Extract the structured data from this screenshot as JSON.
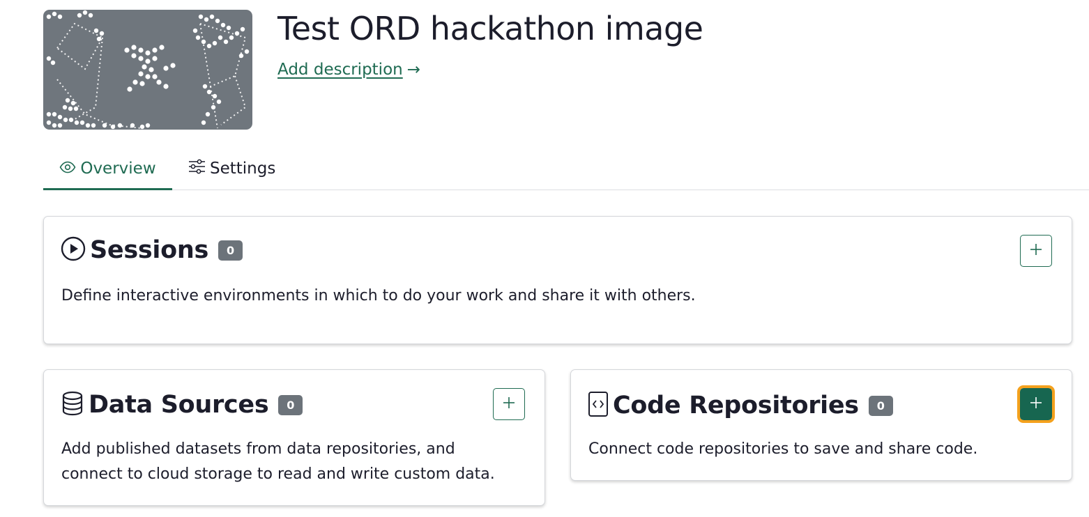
{
  "project": {
    "title": "Test ORD hackathon image",
    "add_description": "Add description",
    "add_description_arrow": "→"
  },
  "tabs": [
    {
      "label": "Overview",
      "icon": "eye-icon",
      "active": true
    },
    {
      "label": "Settings",
      "icon": "sliders-icon",
      "active": false
    }
  ],
  "sections": {
    "sessions": {
      "title": "Sessions",
      "count": "0",
      "icon": "play-circle-icon",
      "description": "Define interactive environments in which to do your work and share it with others."
    },
    "data_sources": {
      "title": "Data Sources",
      "count": "0",
      "icon": "database-icon",
      "description_line1": "Add published datasets from data repositories, and",
      "description_line2": "connect to cloud storage to read and write custom data."
    },
    "code_repositories": {
      "title": "Code Repositories",
      "count": "0",
      "icon": "code-file-icon",
      "description": "Connect code repositories to save and share code."
    }
  },
  "colors": {
    "accent": "#1f6b52",
    "badge": "#6c737a",
    "focus_outline": "#f4a11d",
    "hero_background": "#6f767d"
  }
}
